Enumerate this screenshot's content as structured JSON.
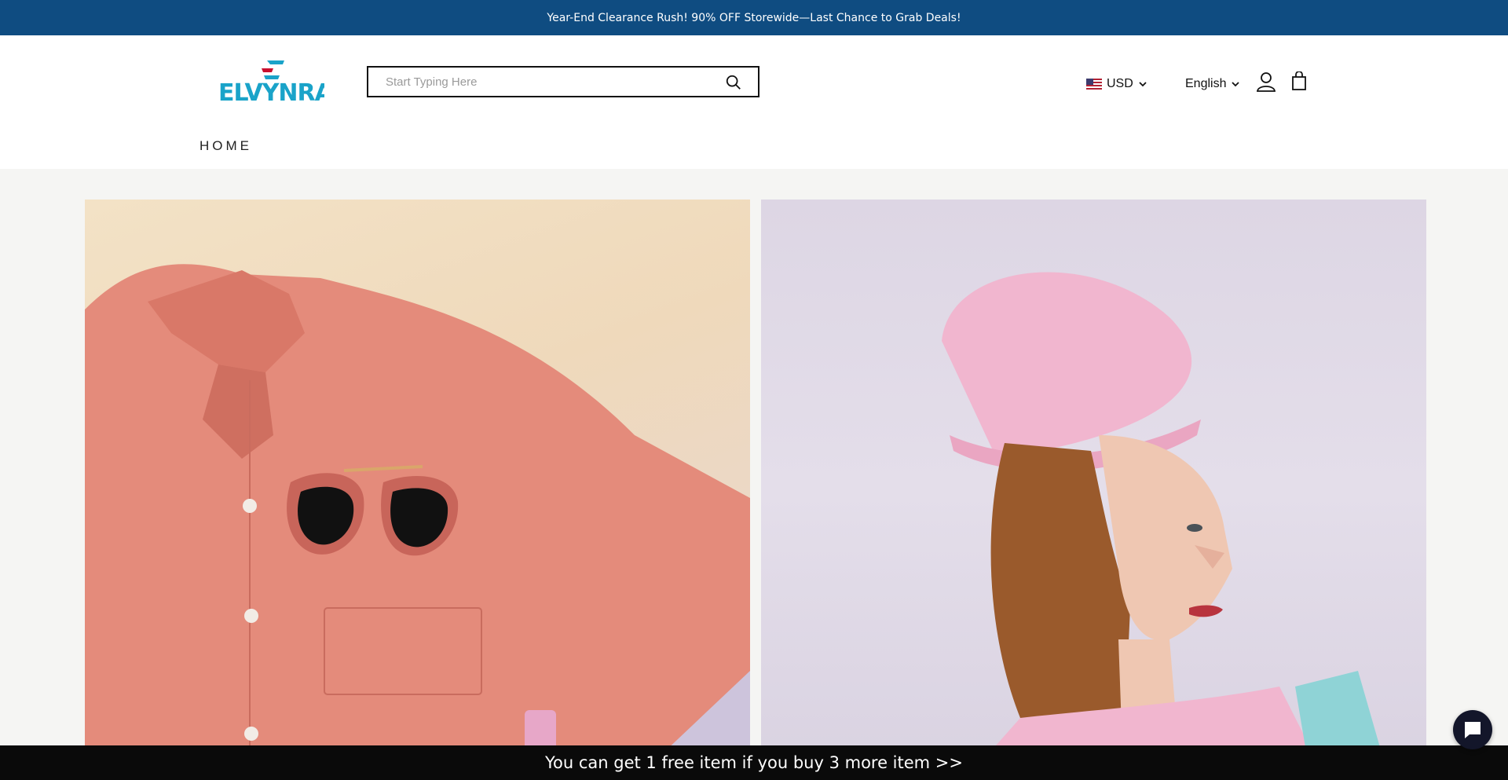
{
  "announcement": {
    "text": "Year-End Clearance Rush! 90% OFF Storewide—Last Chance to Grab Deals!"
  },
  "header": {
    "logo_text": "ELVYNRA",
    "search": {
      "placeholder": "Start Typing Here",
      "value": ""
    },
    "currency": "USD",
    "language": "English"
  },
  "nav": {
    "home": "HOME"
  },
  "banners": [
    {
      "alt": "Coral shirt with sunglasses"
    },
    {
      "alt": "Woman in pink beanie"
    }
  ],
  "promo_bar": {
    "text": "You can get 1 free item if you buy 3 more item  >>"
  },
  "colors": {
    "announcement_bg": "#0f4c81",
    "promo_bg": "#0a0a0a",
    "logo_teal": "#1aa3c9",
    "logo_red": "#c8102e"
  }
}
